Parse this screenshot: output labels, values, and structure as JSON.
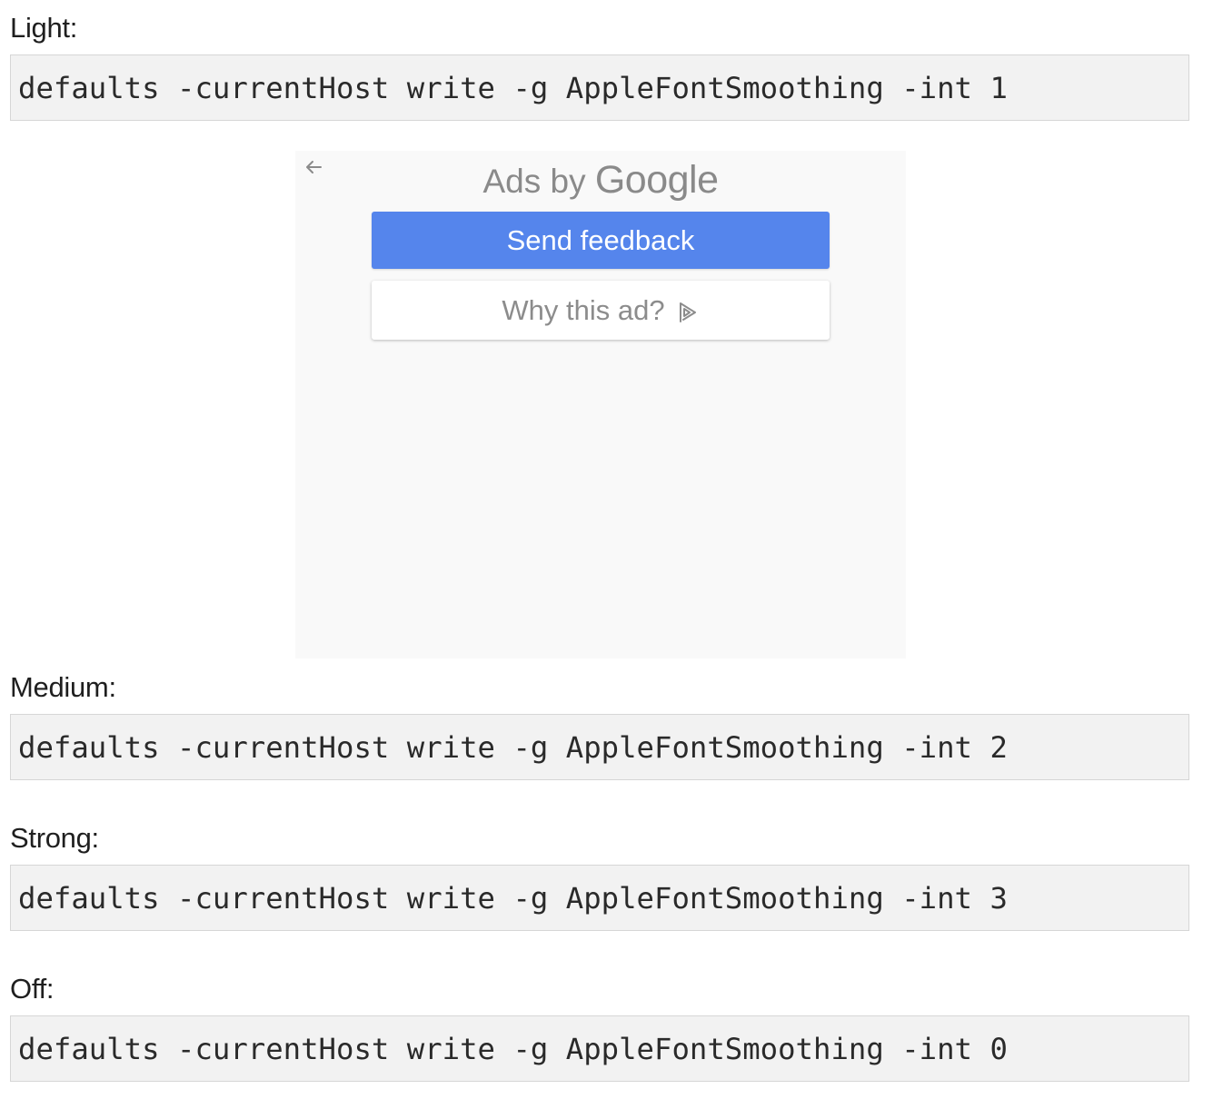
{
  "sections": [
    {
      "label": "Light:",
      "command": "defaults -currentHost write -g AppleFontSmoothing -int 1"
    },
    {
      "label": "Medium:",
      "command": "defaults -currentHost write -g AppleFontSmoothing -int 2"
    },
    {
      "label": "Strong:",
      "command": "defaults -currentHost write -g AppleFontSmoothing -int 3"
    },
    {
      "label": "Off:",
      "command": "defaults -currentHost write -g AppleFontSmoothing -int 0"
    }
  ],
  "ad": {
    "title_prefix": "Ads by",
    "title_brand": "Google",
    "send_feedback_label": "Send feedback",
    "why_this_ad_label": "Why this ad?",
    "back_icon": "arrow-left-icon",
    "adchoices_icon": "adchoices-icon",
    "accent_color": "#5585ec"
  }
}
